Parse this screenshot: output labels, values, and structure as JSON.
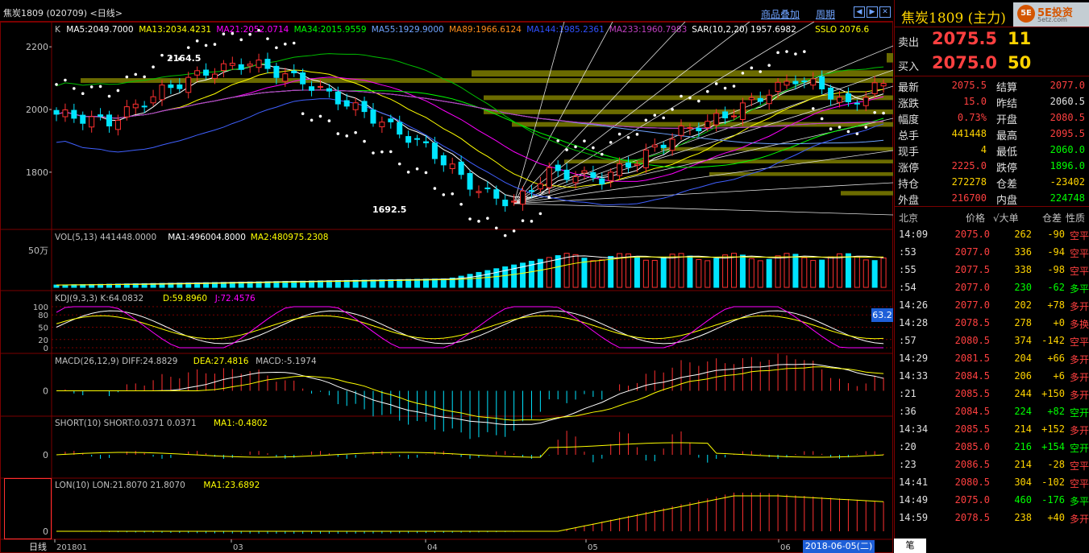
{
  "window": {
    "title": "焦炭1809 (020709) <日线>",
    "overlay_link": "商品叠加",
    "period_link": "周期",
    "nav_icons": [
      "nav-left-icon",
      "nav-right-icon",
      "nav-close-icon"
    ]
  },
  "main_indicator_line": [
    {
      "text": "K",
      "color": "#c0c0c0"
    },
    {
      "text": "MA5:2049.7000",
      "color": "#ffffff"
    },
    {
      "text": "MA13:2034.4231",
      "color": "#ffff00"
    },
    {
      "text": "MA21:2052.0714",
      "color": "#ff00ff"
    },
    {
      "text": "MA34:2015.9559",
      "color": "#00ff00"
    },
    {
      "text": "MA55:1929.9000",
      "color": "#6fa3ff"
    },
    {
      "text": "MA89:1966.6124",
      "color": "#ff8c1a"
    },
    {
      "text": "MA144:1985.2361",
      "color": "#3050ff"
    },
    {
      "text": "MA233:1960.7983",
      "color": "#c040c0"
    },
    {
      "text": "SAR(10,2,20)  1957.6982",
      "color": "#ffffff"
    },
    {
      "text": "SSLO  2076.6",
      "color": "#ffff00"
    }
  ],
  "price_axis": [
    "2200",
    "2000",
    "1800"
  ],
  "annotations": {
    "high": "2164.5",
    "low": "1692.5"
  },
  "vol_header": [
    {
      "text": "VOL(5,13) 441448.0000",
      "color": "#c0c0c0"
    },
    {
      "text": "MA1:496004.8000",
      "color": "#ffffff"
    },
    {
      "text": "MA2:480975.2308",
      "color": "#ffff00"
    }
  ],
  "vol_axis": "50万",
  "kdj_header": [
    {
      "text": "KDJ(9,3,3) K:64.0832",
      "color": "#c0c0c0"
    },
    {
      "text": "D:59.8960",
      "color": "#ffff00"
    },
    {
      "text": "J:72.4576",
      "color": "#ff00ff"
    }
  ],
  "kdj_axis": [
    "100",
    "80",
    "50",
    "20",
    "0"
  ],
  "kdj_badge": "63.2",
  "macd_header": [
    {
      "text": "MACD(26,12,9) DIFF:24.8829",
      "color": "#c0c0c0"
    },
    {
      "text": "DEA:27.4816",
      "color": "#ffff00"
    },
    {
      "text": "MACD:-5.1974",
      "color": "#c0c0c0"
    }
  ],
  "short_header": [
    {
      "text": "SHORT(10) SHORT:0.0371  0.0371",
      "color": "#c0c0c0"
    },
    {
      "text": "MA1:-0.4802",
      "color": "#ffff00"
    }
  ],
  "lon_header": [
    {
      "text": "LON(10) LON:21.8070  21.8070",
      "color": "#c0c0c0"
    },
    {
      "text": "MA1:23.6892",
      "color": "#ffff00"
    }
  ],
  "zero_label": "0",
  "x_axis": {
    "period_label": "日线",
    "ticks": [
      "201801",
      "03",
      "04",
      "05",
      "06"
    ],
    "current_date": "2018-06-05(二)"
  },
  "quote": {
    "title": "焦炭1809 (主力)",
    "brand": "5E投资",
    "brand_sub": "5etz.com",
    "brand_mark": "5E",
    "ask": {
      "label": "卖出",
      "price": "2075.5",
      "qty": "11"
    },
    "bid": {
      "label": "买入",
      "price": "2075.0",
      "qty": "50"
    }
  },
  "stats": [
    {
      "l1": "最新",
      "v1": "2075.5",
      "c1": "#ff4040",
      "l2": "结算",
      "v2": "2077.0",
      "c2": "#ff4040"
    },
    {
      "l1": "涨跌",
      "v1": "15.0",
      "c1": "#ff4040",
      "l2": "昨结",
      "v2": "2060.5",
      "c2": "#e0e0e0"
    },
    {
      "l1": "幅度",
      "v1": "0.73%",
      "c1": "#ff4040",
      "l2": "开盘",
      "v2": "2080.5",
      "c2": "#ff4040"
    },
    {
      "l1": "总手",
      "v1": "441448",
      "c1": "#ffd400",
      "l2": "最高",
      "v2": "2095.5",
      "c2": "#ff4040"
    },
    {
      "l1": "现手",
      "v1": "4",
      "c1": "#ffd400",
      "l2": "最低",
      "v2": "2060.0",
      "c2": "#00ff00"
    },
    {
      "l1": "涨停",
      "v1": "2225.0",
      "c1": "#ff4040",
      "l2": "跌停",
      "v2": "1896.0",
      "c2": "#00ff00"
    },
    {
      "l1": "持仓",
      "v1": "272278",
      "c1": "#ffd400",
      "l2": "仓差",
      "v2": "-23402",
      "c2": "#ffd400"
    },
    {
      "l1": "外盘",
      "v1": "216700",
      "c1": "#ff4040",
      "l2": "内盘",
      "v2": "224748",
      "c2": "#00ff00"
    }
  ],
  "tick_header": {
    "place": "北京",
    "price": "价格",
    "vol": "√大单",
    "oi": "仓差",
    "nature": "性质"
  },
  "ticks": [
    {
      "time": "14:09",
      "price": "2075.0",
      "vol": "262",
      "oi": "-90",
      "nat": "空平",
      "vc": "#ffd400",
      "nc": "#ff4040"
    },
    {
      "time": ":53",
      "price": "2077.0",
      "vol": "336",
      "oi": "-94",
      "nat": "空平",
      "vc": "#ffd400",
      "nc": "#ff4040"
    },
    {
      "time": ":55",
      "price": "2077.5",
      "vol": "338",
      "oi": "-98",
      "nat": "空平",
      "vc": "#ffd400",
      "nc": "#ff4040"
    },
    {
      "time": ":54",
      "price": "2077.0",
      "vol": "230",
      "oi": "-62",
      "nat": "多平",
      "vc": "#00ff00",
      "nc": "#00ff00"
    },
    {
      "time": "14:26",
      "price": "2077.0",
      "vol": "202",
      "oi": "+78",
      "nat": "多开",
      "vc": "#ffd400",
      "nc": "#ff4040"
    },
    {
      "time": "14:28",
      "price": "2078.5",
      "vol": "278",
      "oi": "+0",
      "nat": "多换",
      "vc": "#ffd400",
      "nc": "#ff4040"
    },
    {
      "time": ":57",
      "price": "2080.5",
      "vol": "374",
      "oi": "-142",
      "nat": "空平",
      "vc": "#ffd400",
      "nc": "#ff4040"
    },
    {
      "time": "14:29",
      "price": "2081.5",
      "vol": "204",
      "oi": "+66",
      "nat": "多开",
      "vc": "#ffd400",
      "nc": "#ff4040"
    },
    {
      "time": "14:33",
      "price": "2084.5",
      "vol": "206",
      "oi": "+6",
      "nat": "多开",
      "vc": "#ffd400",
      "nc": "#ff4040"
    },
    {
      "time": ":21",
      "price": "2085.5",
      "vol": "244",
      "oi": "+150",
      "nat": "多开",
      "vc": "#ffd400",
      "nc": "#ff4040"
    },
    {
      "time": ":36",
      "price": "2084.5",
      "vol": "224",
      "oi": "+82",
      "nat": "空开",
      "vc": "#00ff00",
      "nc": "#00ff00"
    },
    {
      "time": "14:34",
      "price": "2085.5",
      "vol": "214",
      "oi": "+152",
      "nat": "多开",
      "vc": "#ffd400",
      "nc": "#ff4040"
    },
    {
      "time": ":20",
      "price": "2085.0",
      "vol": "216",
      "oi": "+154",
      "nat": "空开",
      "vc": "#00ff00",
      "nc": "#00ff00"
    },
    {
      "time": ":23",
      "price": "2086.5",
      "vol": "214",
      "oi": "-28",
      "nat": "空平",
      "vc": "#ffd400",
      "nc": "#ff4040"
    },
    {
      "time": "14:41",
      "price": "2080.5",
      "vol": "304",
      "oi": "-102",
      "nat": "空平",
      "vc": "#ffd400",
      "nc": "#ff4040"
    },
    {
      "time": "14:49",
      "price": "2075.0",
      "vol": "460",
      "oi": "-176",
      "nat": "多平",
      "vc": "#00ff00",
      "nc": "#00ff00"
    },
    {
      "time": "14:59",
      "price": "2078.5",
      "vol": "238",
      "oi": "+40",
      "nat": "多开",
      "vc": "#ffd400",
      "nc": "#ff4040"
    }
  ],
  "pen_tab": "笔",
  "colors": {
    "up": "#ff3030",
    "down": "#00e5ff",
    "grid": "#7a0000",
    "band": "#6b6b00"
  }
}
